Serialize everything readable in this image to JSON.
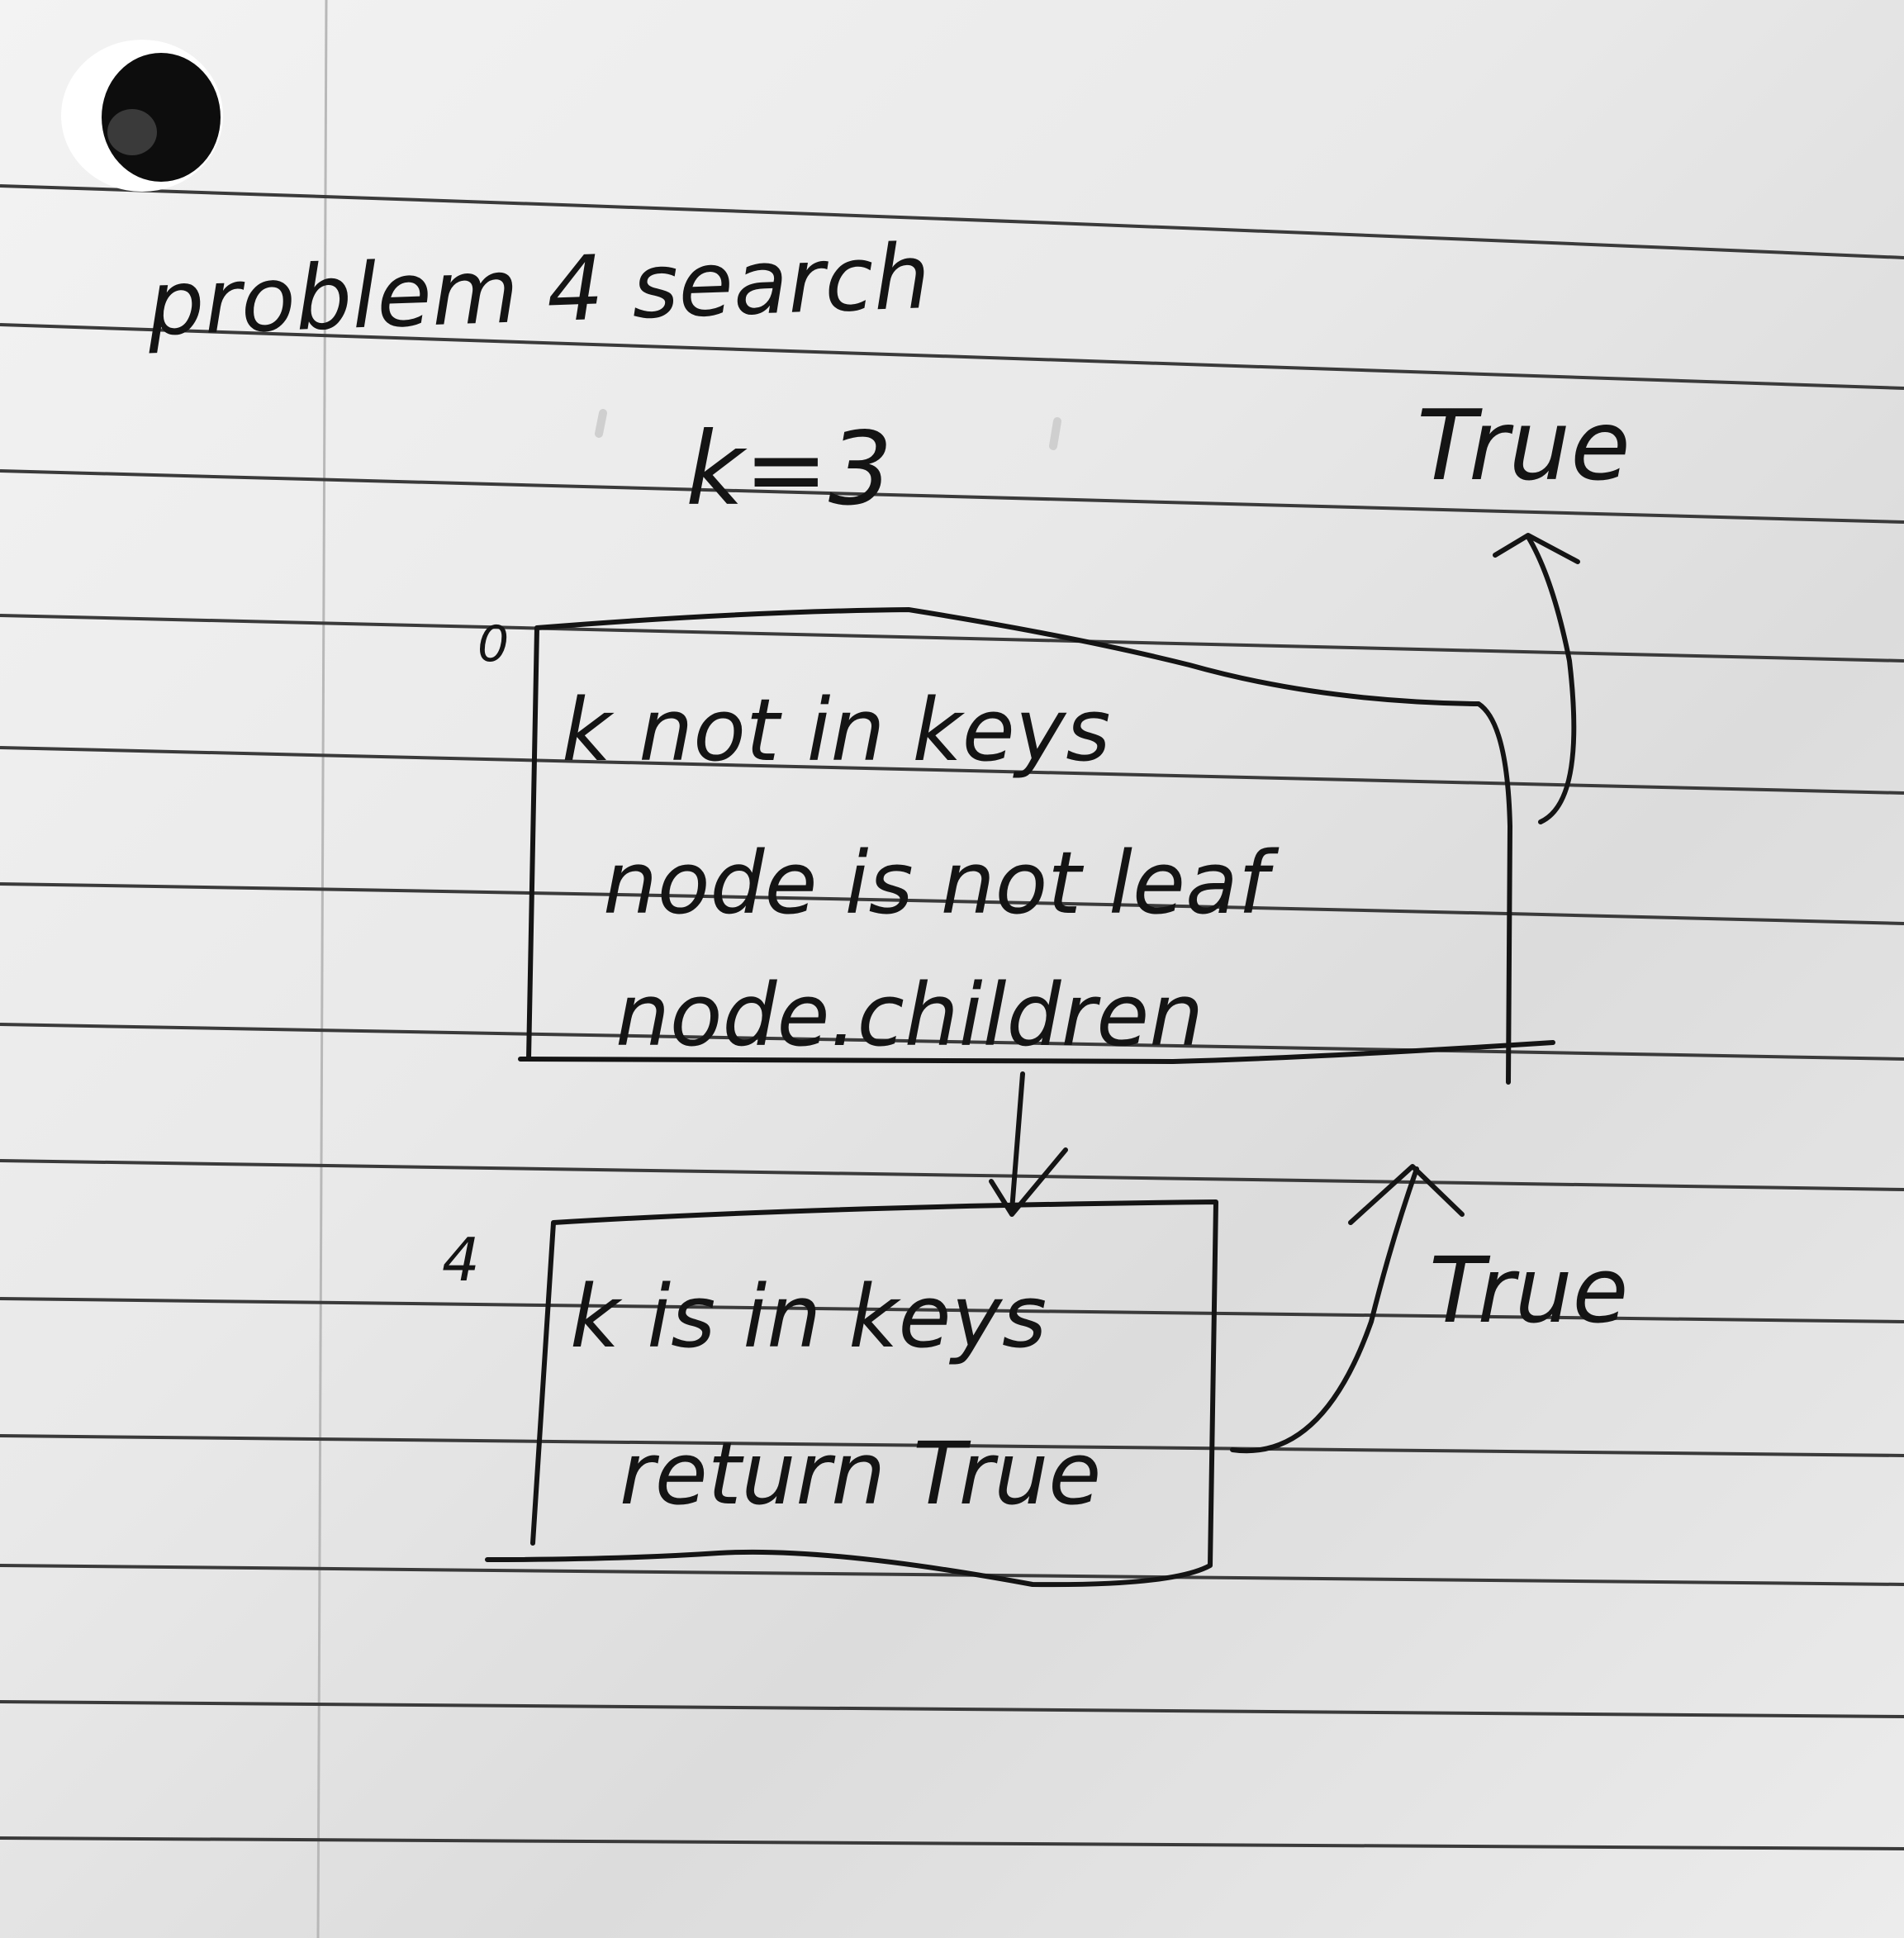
{
  "page": {
    "title": "problem 4 search",
    "parameter": "k=3",
    "top_result": "True",
    "side_result": "True"
  },
  "nodes": [
    {
      "label": "0",
      "lines": [
        "k not in keys",
        "node is not leaf",
        "node.children"
      ]
    },
    {
      "label": "4",
      "lines": [
        "k is in keys",
        "return True"
      ]
    }
  ],
  "colors": {
    "paper": "#eeeeee",
    "ruling": "#3c3c3c",
    "ink": "#141414"
  }
}
